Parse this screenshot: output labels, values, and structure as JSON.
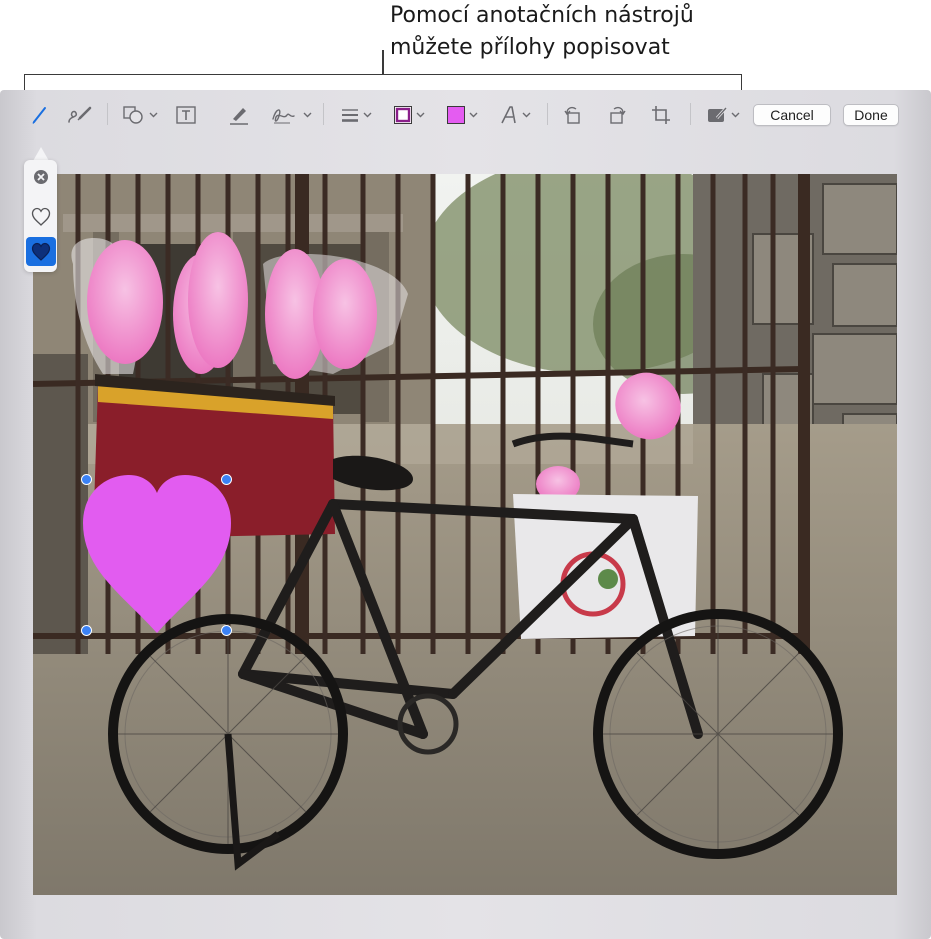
{
  "callout": {
    "line1": "Pomocí anotačních nástrojů",
    "line2": "můžete přílohy popisovat"
  },
  "toolbar": {
    "items": [
      {
        "name": "sketch-icon",
        "active": true
      },
      {
        "name": "draw-icon"
      },
      {
        "name": "shapes-icon",
        "menu": true
      },
      {
        "name": "text-icon"
      },
      {
        "name": "highlight-icon"
      },
      {
        "name": "signature-icon",
        "menu": true
      },
      {
        "name": "shape-style-icon",
        "menu": true
      },
      {
        "name": "border-color-icon",
        "menu": true
      },
      {
        "name": "fill-color-icon",
        "menu": true
      },
      {
        "name": "text-style-icon",
        "menu": true
      },
      {
        "name": "rotate-left-icon"
      },
      {
        "name": "rotate-right-icon"
      },
      {
        "name": "crop-icon"
      },
      {
        "name": "markup-options-icon",
        "menu": true
      }
    ],
    "cancel_label": "Cancel",
    "done_label": "Done"
  },
  "popover": {
    "items": [
      {
        "name": "clear-icon"
      },
      {
        "name": "heart-outline-icon"
      },
      {
        "name": "heart-filled-icon",
        "selected": true
      }
    ]
  },
  "colors": {
    "accent": "#1a6fe0",
    "border_color": "#8a1e8a",
    "fill_color": "#e45cf1",
    "heart": "#e25cf0",
    "handle": "#3b82f6"
  }
}
